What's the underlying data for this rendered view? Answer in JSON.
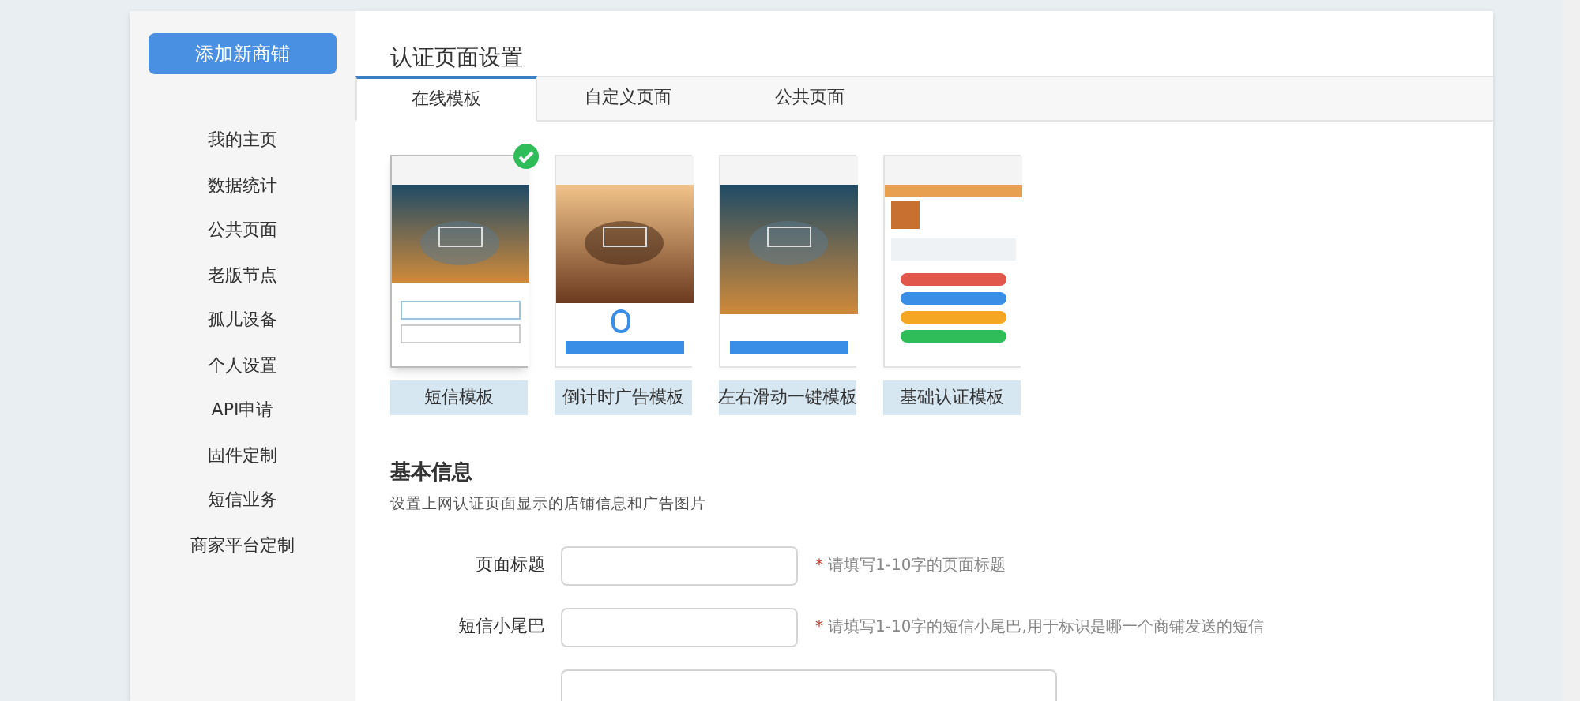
{
  "sidebar": {
    "add_button": "添加新商铺",
    "items": [
      "我的主页",
      "数据统计",
      "公共页面",
      "老版节点",
      "孤儿设备",
      "个人设置",
      "API申请",
      "固件定制",
      "短信业务",
      "商家平台定制"
    ]
  },
  "page_title": "认证页面设置",
  "tabs": [
    {
      "label": "在线模板",
      "selected": true
    },
    {
      "label": "自定义页面",
      "selected": false
    },
    {
      "label": "公共页面",
      "selected": false
    }
  ],
  "templates": [
    {
      "label": "短信模板",
      "selected": true,
      "kind": "picture"
    },
    {
      "label": "倒计时广告模板",
      "selected": false,
      "kind": "picture"
    },
    {
      "label": "左右滑动一键模板",
      "selected": false,
      "kind": "picture"
    },
    {
      "label": "基础认证模板",
      "selected": false,
      "kind": "picture"
    }
  ],
  "section": {
    "title": "基本信息",
    "subtitle": "设置上网认证页面显示的店铺信息和广告图片"
  },
  "fields": [
    {
      "label": "页面标题",
      "mark": "*",
      "hint": "请填写1-10字的页面标题"
    },
    {
      "label": "短信小尾巴",
      "mark": "*",
      "hint": "请填写1-10字的短信小尾巴,用于标识是哪一个商铺发送的短信"
    }
  ]
}
